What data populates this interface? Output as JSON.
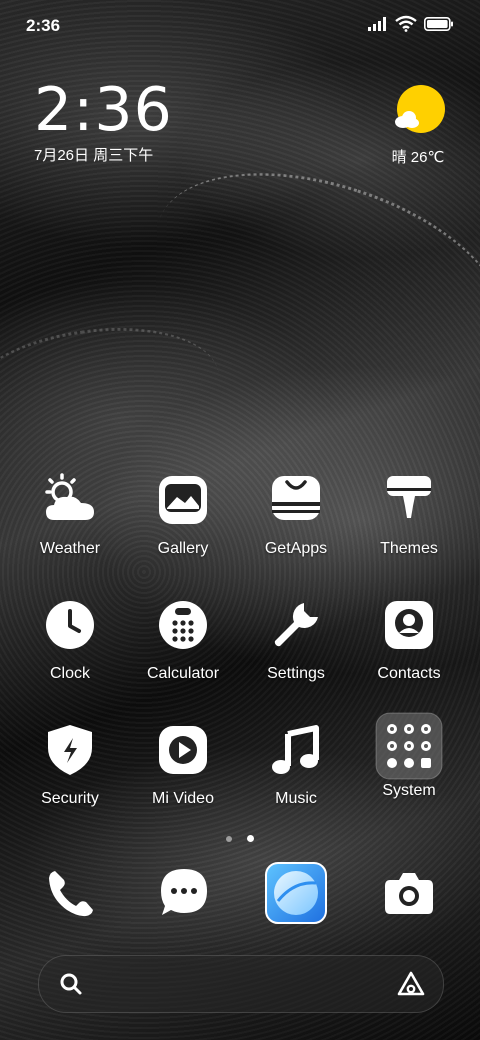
{
  "status_bar": {
    "time": "2:36"
  },
  "clock_widget": {
    "time": "2:36",
    "date": "7月26日 周三下午"
  },
  "weather_widget": {
    "text": "晴 26℃",
    "sun_color": "#FFD000"
  },
  "apps": [
    {
      "label": "Weather",
      "icon": "weather-icon"
    },
    {
      "label": "Gallery",
      "icon": "gallery-icon"
    },
    {
      "label": "GetApps",
      "icon": "getapps-icon"
    },
    {
      "label": "Themes",
      "icon": "themes-icon"
    },
    {
      "label": "Clock",
      "icon": "clock-icon"
    },
    {
      "label": "Calculator",
      "icon": "calculator-icon"
    },
    {
      "label": "Settings",
      "icon": "settings-icon"
    },
    {
      "label": "Contacts",
      "icon": "contacts-icon"
    },
    {
      "label": "Security",
      "icon": "security-icon"
    },
    {
      "label": "Mi Video",
      "icon": "mi-video-icon"
    },
    {
      "label": "Music",
      "icon": "music-icon"
    },
    {
      "label": "System",
      "icon": "system-folder-icon"
    }
  ],
  "page_indicator": {
    "pages": 2,
    "active_page": 2
  },
  "dock": [
    {
      "icon": "phone-icon"
    },
    {
      "icon": "messages-icon"
    },
    {
      "icon": "browser-icon",
      "accent": "#2E8FF0"
    },
    {
      "icon": "camera-icon"
    }
  ],
  "search_bar": {
    "icons": [
      "search-icon",
      "assistant-icon"
    ]
  }
}
